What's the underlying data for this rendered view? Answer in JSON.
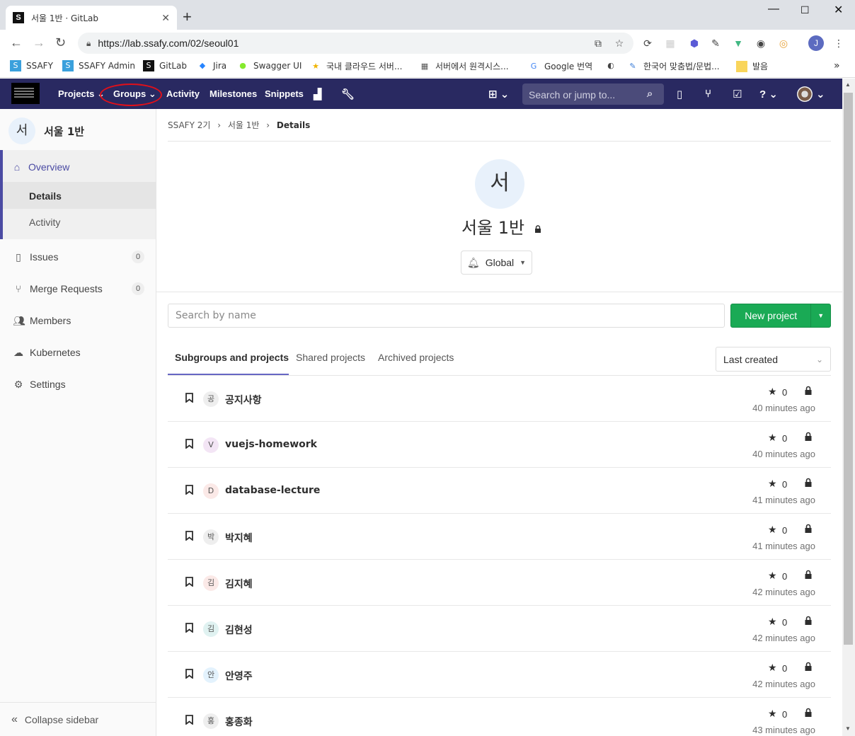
{
  "browser": {
    "tab_title": "서울 1반 · GitLab",
    "tab_favicon": "S",
    "url": "https://lab.ssafy.com/02/seoul01",
    "bookmarks": [
      {
        "label": "SSAFY",
        "icon": "ssafy-icon"
      },
      {
        "label": "SSAFY Admin",
        "icon": "ssafy-icon"
      },
      {
        "label": "GitLab",
        "icon": "gitlab-icon"
      },
      {
        "label": "Jira",
        "icon": "jira-icon"
      },
      {
        "label": "Swagger UI",
        "icon": "swagger-icon"
      },
      {
        "label": "국내 클라우드 서버...",
        "icon": "star-icon"
      },
      {
        "label": "서버에서 원격시스...",
        "icon": "grid-icon"
      },
      {
        "label": "Google 번역",
        "icon": "translate-icon"
      },
      {
        "label": "",
        "icon": "globe-icon"
      },
      {
        "label": "한국어 맞춤법/문법...",
        "icon": "spell-icon"
      },
      {
        "label": "발음",
        "icon": "folder-icon"
      }
    ]
  },
  "gitlab_nav": {
    "projects": "Projects",
    "groups": "Groups",
    "activity": "Activity",
    "milestones": "Milestones",
    "snippets": "Snippets",
    "search_placeholder": "Search or jump to...",
    "colors": {
      "nav_bg": "#292961",
      "highlight_circle": "#e0101a"
    }
  },
  "sidebar": {
    "context_avatar": "서",
    "context_name": "서울 1반",
    "overview": "Overview",
    "details": "Details",
    "activity": "Activity",
    "issues": "Issues",
    "issues_count": "0",
    "merge_requests": "Merge Requests",
    "merge_requests_count": "0",
    "members": "Members",
    "kubernetes": "Kubernetes",
    "settings": "Settings",
    "collapse": "Collapse sidebar"
  },
  "breadcrumb": {
    "items": [
      "SSAFY 2기",
      "서울 1반",
      "Details"
    ]
  },
  "group": {
    "avatar": "서",
    "name": "서울 1반",
    "notification": "Global"
  },
  "toolbar": {
    "search_placeholder": "Search by name",
    "new_project": "New project",
    "accent": "#1aaa55"
  },
  "tabs": {
    "subgroups": "Subgroups and projects",
    "shared": "Shared projects",
    "archived": "Archived projects",
    "sort": "Last created"
  },
  "projects": [
    {
      "avatar": "공",
      "name": "공지사항",
      "stars": "0",
      "time": "40 minutes ago",
      "avatar_bg": "#eeeeee"
    },
    {
      "avatar": "V",
      "name": "vuejs-homework",
      "stars": "0",
      "time": "40 minutes ago",
      "avatar_bg": "#f3e5f5"
    },
    {
      "avatar": "D",
      "name": "database-lecture",
      "stars": "0",
      "time": "41 minutes ago",
      "avatar_bg": "#fbe9e7"
    },
    {
      "avatar": "박",
      "name": "박지혜",
      "stars": "0",
      "time": "41 minutes ago",
      "avatar_bg": "#eeeeee"
    },
    {
      "avatar": "김",
      "name": "김지혜",
      "stars": "0",
      "time": "42 minutes ago",
      "avatar_bg": "#fbe9e7"
    },
    {
      "avatar": "김",
      "name": "김현성",
      "stars": "0",
      "time": "42 minutes ago",
      "avatar_bg": "#e0f2f1"
    },
    {
      "avatar": "안",
      "name": "안영주",
      "stars": "0",
      "time": "42 minutes ago",
      "avatar_bg": "#e3f2fd"
    },
    {
      "avatar": "홍",
      "name": "홍종화",
      "stars": "0",
      "time": "43 minutes ago",
      "avatar_bg": "#eeeeee"
    }
  ]
}
